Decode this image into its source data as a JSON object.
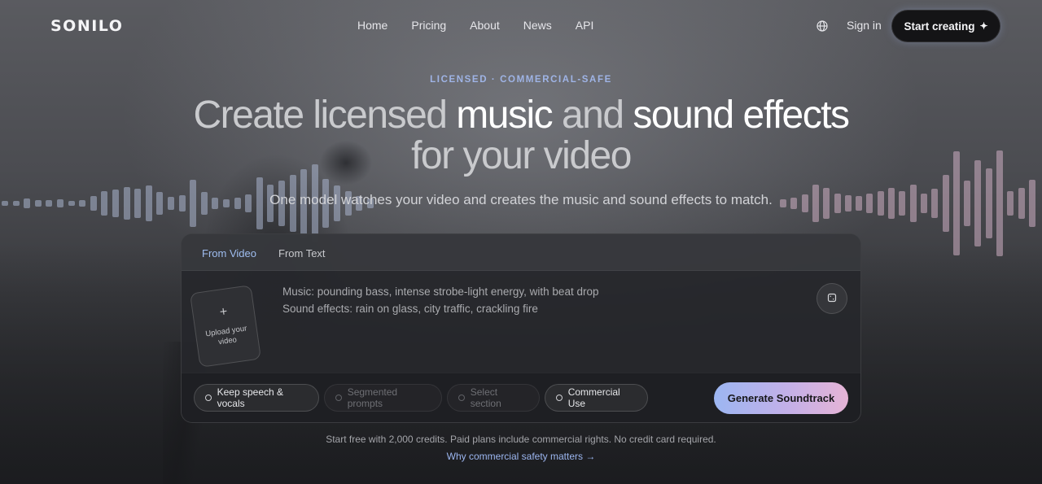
{
  "brand": {
    "logo": "SONILO"
  },
  "nav": {
    "items": [
      {
        "label": "Home"
      },
      {
        "label": "Pricing"
      },
      {
        "label": "About"
      },
      {
        "label": "News"
      },
      {
        "label": "API"
      }
    ],
    "globe_icon": "globe-icon",
    "signin_label": "Sign in",
    "cta_label": "Start creating",
    "cta_icon": "✦"
  },
  "hero": {
    "eyebrow": "LICENSED · COMMERCIAL-SAFE",
    "headline": {
      "part1": "Create licensed ",
      "part2": "music",
      "part3": " and ",
      "part4": "sound effects",
      "line2": "for your video"
    },
    "subtitle": "One model watches your video and creates the music and sound effects to match."
  },
  "composer": {
    "tabs": [
      {
        "label": "From Video",
        "active": true
      },
      {
        "label": "From Text",
        "active": false
      }
    ],
    "upload": {
      "icon": "plus-icon",
      "label": "Upload your video"
    },
    "prompt_lines": [
      "Music: pounding bass, intense strobe-light energy, with beat drop",
      "Sound effects: rain on glass, city traffic, crackling fire"
    ],
    "options": [
      {
        "label": "Keep speech & vocals",
        "enabled": true
      },
      {
        "label": "Segmented prompts",
        "enabled": false
      },
      {
        "label": "Select section",
        "enabled": false
      },
      {
        "label": "Commercial Use",
        "enabled": true
      }
    ],
    "side_icon": "dice-icon",
    "generate_label": "Generate Soundtrack"
  },
  "footer": {
    "note": "Start free with 2,000 credits. Paid plans include commercial rights. No credit card required.",
    "link_label": "Why commercial safety matters →"
  },
  "colors": {
    "accent_blue": "#9fbdf0",
    "gradient_start": "#9cb6f2",
    "gradient_end": "#e6b4d6"
  }
}
